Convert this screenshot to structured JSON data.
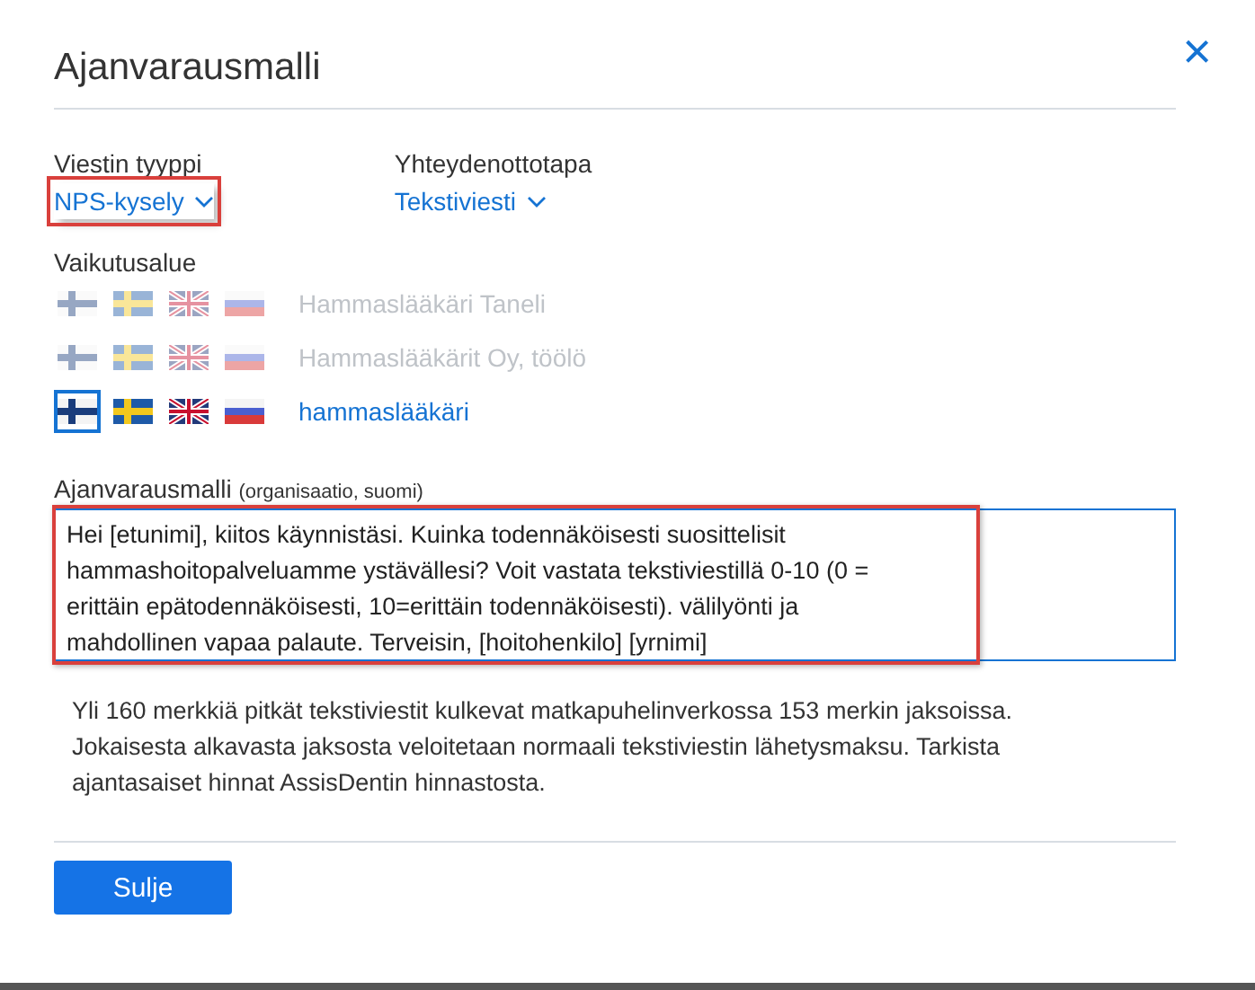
{
  "dialog": {
    "title": "Ajanvarausmalli",
    "close": "×"
  },
  "message_type": {
    "label": "Viestin tyyppi",
    "value": "NPS-kysely",
    "highlighted": true
  },
  "contact_method": {
    "label": "Yhteydenottotapa",
    "value": "Tekstiviesti",
    "highlighted": false
  },
  "scope": {
    "label": "Vaikutusalue",
    "rows": [
      {
        "name": "Hammaslääkäri Taneli",
        "disabled": true,
        "flags": [
          {
            "kind": "fi",
            "selected": false
          },
          {
            "kind": "se",
            "selected": false
          },
          {
            "kind": "gb",
            "selected": false
          },
          {
            "kind": "ru",
            "selected": false
          }
        ]
      },
      {
        "name": "Hammaslääkärit Oy, töölö",
        "disabled": true,
        "flags": [
          {
            "kind": "fi",
            "selected": false
          },
          {
            "kind": "se",
            "selected": false
          },
          {
            "kind": "gb",
            "selected": false
          },
          {
            "kind": "ru",
            "selected": false
          }
        ]
      },
      {
        "name": "hammaslääkäri",
        "disabled": false,
        "flags": [
          {
            "kind": "fi",
            "selected": true
          },
          {
            "kind": "se",
            "selected": false
          },
          {
            "kind": "gb",
            "selected": false
          },
          {
            "kind": "ru",
            "selected": false
          }
        ]
      }
    ]
  },
  "template": {
    "label": "Ajanvarausmalli",
    "sublabel": "(organisaatio, suomi)",
    "value": "Hei [etunimi], kiitos käynnistäsi. Kuinka todennäköisesti suosittelisit hammashoitopalveluamme ystävällesi? Voit vastata tekstiviestillä 0-10 (0 = erittäin epätodennäköisesti, 10=erittäin todennäköisesti). välilyönti ja mahdollinen vapaa palaute. Terveisin, [hoitohenkilo] [yrnimi]",
    "highlighted": true
  },
  "note": "Yli 160 merkkiä pitkät tekstiviestit kulkevat matkapuhelinverkossa 153 merkin jaksoissa. Jokaisesta alkavasta jaksosta veloitetaan normaali tekstiviestin lähetysmaksu. Tarkista ajantasaiset hinnat AssisDentin hinnastosta.",
  "buttons": [
    {
      "label": "Sulje",
      "kind": "primary"
    }
  ]
}
